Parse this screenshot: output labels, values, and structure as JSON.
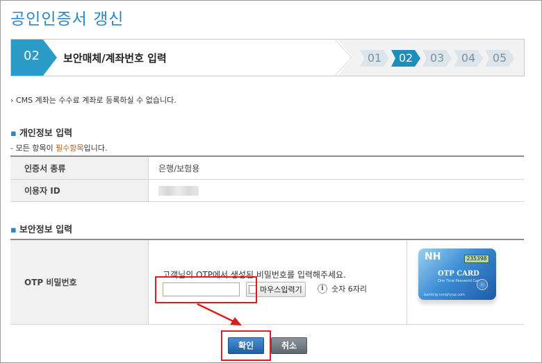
{
  "page_title": "공인인증서 갱신",
  "stepbar": {
    "current_num": "02",
    "current_label": "보안매체/계좌번호 입력",
    "steps": [
      "01",
      "02",
      "03",
      "04",
      "05"
    ],
    "active_index": 1
  },
  "notice": "› CMS 계좌는 수수료 계좌로 등록하실 수 없습니다.",
  "personal": {
    "title": "개인정보 입력",
    "note_prefix": "- 모든 항목이 ",
    "note_required": "필수항목",
    "note_suffix": "입니다.",
    "rows": [
      {
        "label": "인증서 종류",
        "value": "은행/보험용"
      },
      {
        "label": "이용자 ID",
        "value": ""
      }
    ]
  },
  "security": {
    "title": "보안정보 입력",
    "otp_label": "OTP 비밀번호",
    "guide": "고객님의 OTP에서 생성된 비밀번호를 입력해주세요.",
    "otp_value": "",
    "mouse_input_label": "마우스입력기",
    "info_icon": "i",
    "digits_note": "숫자 6자리"
  },
  "otp_card": {
    "brand": "NH",
    "lcd": "235398",
    "name": "OTP CARD",
    "subtitle": "One Time Password Card",
    "url": "banking.nonghyup.com"
  },
  "buttons": {
    "confirm": "확인",
    "cancel": "취소"
  },
  "colors": {
    "accent": "#2b86c4",
    "highlight": "#e01b1b",
    "required": "#b4611c"
  }
}
